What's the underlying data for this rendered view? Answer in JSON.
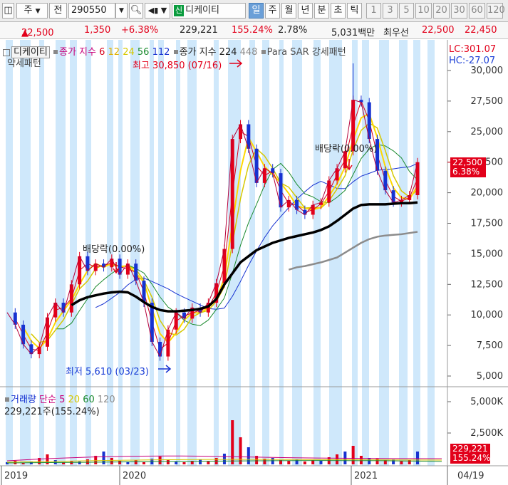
{
  "toolbar": {
    "type_label": "주",
    "prev_label": "전",
    "code": "290550",
    "badge": "신",
    "stock_name": "디케이티",
    "periods": [
      "일",
      "주",
      "월",
      "년",
      "분",
      "초",
      "틱"
    ],
    "selected_period": "일",
    "intervals": [
      "1",
      "3",
      "5",
      "10",
      "20",
      "30",
      "60",
      "120"
    ]
  },
  "quote": {
    "price": "22,500",
    "change": "1,350",
    "change_pct": "+6.38%",
    "volume": "229,221",
    "volume_pct": "155.24%",
    "turnover_pct": "2.78%",
    "amount": "5,031백만",
    "best_label": "최우선",
    "ask": "22,500",
    "bid": "22,450"
  },
  "legend": {
    "stock": "디케이티",
    "ma_label": "종가 지수",
    "ma_periods": [
      "6",
      "12",
      "24",
      "56",
      "112"
    ],
    "ma2_label": "종가 지수 224",
    "ma2_extra": "448",
    "sar_label": "Para SAR",
    "pattern_label": "강세패턴",
    "pattern_sub": "약세패턴",
    "lc": "LC:301.07",
    "hc": "HC:-27.07"
  },
  "annotations": {
    "high": "최고 30,850 (07/16)",
    "low": "최저 5,610 (03/23)",
    "dividend1": "배당락(0.00%)",
    "dividend2": "배당락(0.00%)"
  },
  "price_tag": {
    "price": "22,500",
    "pct": "6.38%"
  },
  "volume_legend": {
    "label": "거래량",
    "ma_label": "단순",
    "periods": [
      "5",
      "20",
      "60",
      "120"
    ],
    "value": "229,221주(155.24%)"
  },
  "volume_tag": {
    "value": "229,221",
    "pct": "155.24%"
  },
  "chart_data": {
    "type": "line",
    "price_axis": {
      "min": 5000,
      "max": 30000,
      "ticks": [
        "30,000",
        "27,500",
        "25,000",
        "22,500",
        "20,000",
        "17,500",
        "15,000",
        "12,500",
        "10,000",
        "7,500",
        "5,000"
      ]
    },
    "volume_axis": {
      "ticks": [
        "5,000K",
        "2,500K"
      ]
    },
    "x_labels": [
      "2019",
      "2020",
      "2021",
      "04/19"
    ],
    "series": [
      {
        "name": "디케이티",
        "values": [
          10200,
          9200,
          7600,
          6800,
          7400,
          9800,
          11000,
          10200,
          12500,
          14800,
          13600,
          14200,
          13900,
          14600,
          13300,
          14200,
          12800,
          11000,
          7800,
          6600,
          8800,
          10200,
          9700,
          10600,
          10200,
          11000,
          12600,
          15400,
          24400,
          25600,
          23600,
          20800,
          22000,
          21600,
          18800,
          19400,
          18600,
          18200,
          19000,
          19200,
          21000,
          22000,
          23400,
          27600,
          27400,
          24400,
          21800,
          20200,
          19200,
          19400,
          19800,
          22500
        ]
      },
      {
        "name": "224",
        "values": [
          null,
          null,
          null,
          null,
          null,
          null,
          null,
          null,
          10800,
          11200,
          11450,
          11600,
          11750,
          11850,
          11900,
          11850,
          11500,
          11050,
          10650,
          10400,
          10300,
          10300,
          10350,
          10400,
          10500,
          10700,
          11300,
          12500,
          13400,
          14300,
          14800,
          15300,
          15600,
          15900,
          16100,
          16300,
          16450,
          16600,
          16750,
          16950,
          17250,
          17700,
          18200,
          18700,
          19000,
          19050,
          19050,
          19050,
          19100,
          19150,
          19150,
          19200
        ]
      },
      {
        "name": "448",
        "values": [
          null,
          null,
          null,
          null,
          null,
          null,
          null,
          null,
          null,
          null,
          null,
          null,
          null,
          null,
          null,
          null,
          null,
          null,
          null,
          null,
          null,
          null,
          null,
          null,
          null,
          null,
          null,
          null,
          null,
          null,
          null,
          null,
          null,
          null,
          null,
          13700,
          13900,
          14000,
          14150,
          14300,
          14500,
          14700,
          15100,
          15500,
          15900,
          16200,
          16400,
          16500,
          16550,
          16600,
          16700,
          16800
        ]
      }
    ]
  }
}
